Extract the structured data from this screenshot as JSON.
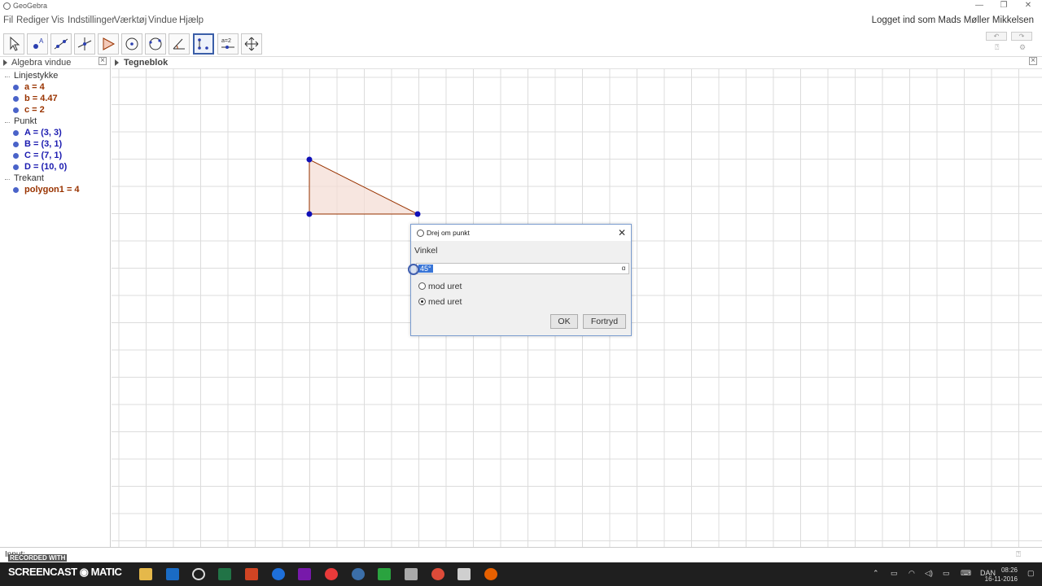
{
  "window": {
    "title": "GeoGebra",
    "login": "Logget ind som Mads Møller Mikkelsen"
  },
  "menu": [
    "Fil",
    "Rediger",
    "Vis",
    "Indstillinger",
    "Værktøj",
    "Vindue",
    "Hjælp"
  ],
  "toolbar": {
    "tools": [
      "move-tool",
      "point-tool",
      "line-tool",
      "perpendicular-tool",
      "polygon-tool",
      "circle-tool",
      "circle-three-points-tool",
      "angle-tool",
      "rotate-around-point-tool",
      "slider-tool",
      "move-graphics-tool"
    ],
    "active_tool": "rotate-around-point-tool",
    "slider_label": "a=2"
  },
  "algebra": {
    "title": "Algebra vindue",
    "groups": [
      {
        "name": "Linjestykke",
        "items": [
          "a = 4",
          "b = 4.47",
          "c = 2"
        ]
      },
      {
        "name": "Punkt",
        "items": [
          "A = (3, 3)",
          "B = (3, 1)",
          "C = (7, 1)",
          "D = (10, 0)"
        ]
      },
      {
        "name": "Trekant",
        "items": [
          "polygon1 = 4"
        ]
      }
    ]
  },
  "graphics": {
    "title": "Tegneblok"
  },
  "dialog": {
    "title": "Drej om punkt",
    "field_label": "Vinkel",
    "input_value": "45°",
    "alpha_symbol": "α",
    "options": [
      "mod uret",
      "med uret"
    ],
    "selected_option": "med uret",
    "ok_label": "OK",
    "cancel_label": "Fortryd"
  },
  "inputbar": {
    "label": "Input:",
    "recorded": "RECORDED WITH"
  },
  "taskbar": {
    "brand": "SCREENCAST ◉ MATIC",
    "lang": "DAN",
    "time": "08:26",
    "date": "16-11-2016"
  },
  "colors": {
    "segment": "#993300",
    "point": "#1b1bb0",
    "dot": "#4a63c9",
    "polygon_fill": "#f3dcd3",
    "accent": "#3a5ea8"
  }
}
